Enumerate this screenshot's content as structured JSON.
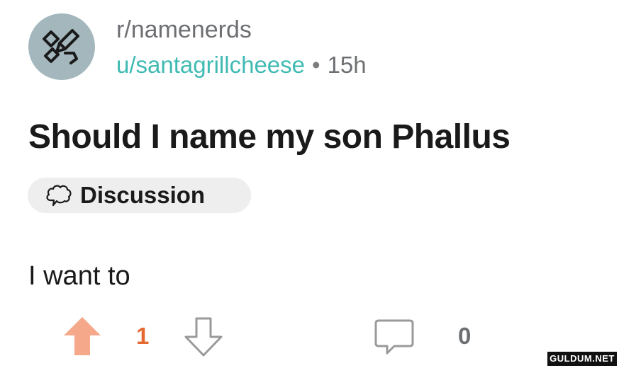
{
  "post": {
    "subreddit": "r/namenerds",
    "username": "u/santagrillcheese",
    "separator": "•",
    "time": "15h",
    "title": "Should I name my son Phallus",
    "flair": "Discussion",
    "body": "I want to",
    "score": "1",
    "comment_count": "0"
  },
  "colors": {
    "avatar_bg": "#a3b7bd",
    "username": "#3fbab3",
    "upvote_active": "#f5a88a",
    "score": "#e56a32"
  },
  "icons": {
    "avatar": "pencil-and-name-tag-icon",
    "flair": "speech-bubble-icon",
    "upvote": "upvote-arrow-icon",
    "downvote": "downvote-arrow-icon",
    "comment": "comment-bubble-icon"
  },
  "watermark": "GULDUM.NET"
}
